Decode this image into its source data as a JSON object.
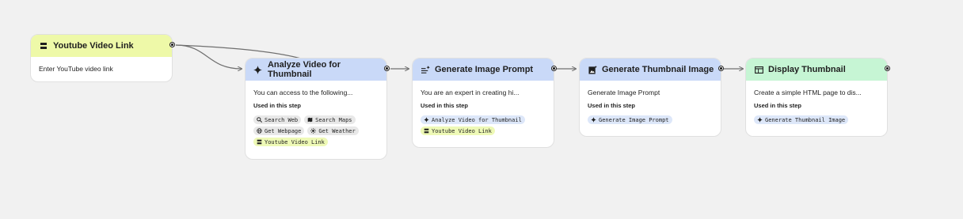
{
  "colors": {
    "canvas_bg": "#f1f1f1",
    "input_header": "#eef9a8",
    "generate_header": "#c9d9f8",
    "output_header": "#c6f5d4",
    "chip_link": "#eef9b6",
    "chip_ai": "#dde7f9",
    "chip_tool": "#e8e8e8"
  },
  "nodes": {
    "youtube": {
      "title": "Youtube Video Link",
      "icon": "input-icon",
      "description": "Enter YouTube video link"
    },
    "analyze": {
      "title": "Analyze Video for Thumbnail",
      "icon": "sparkle-icon",
      "description": "You can access to the following...",
      "used_label": "Used in this step",
      "chips": [
        {
          "label": "Search Web",
          "icon": "search-icon"
        },
        {
          "label": "Search Maps",
          "icon": "map-icon"
        },
        {
          "label": "Get Webpage",
          "icon": "globe-icon"
        },
        {
          "label": "Get Weather",
          "icon": "sun-icon"
        },
        {
          "label": "Youtube Video Link",
          "icon": "input-icon"
        }
      ]
    },
    "prompt": {
      "title": "Generate Image Prompt",
      "icon": "text-generate-icon",
      "description": "You are an expert in creating hi...",
      "used_label": "Used in this step",
      "chips": [
        {
          "label": "Analyze Video for Thumbnail",
          "icon": "sparkle-icon"
        },
        {
          "label": "Youtube Video Link",
          "icon": "input-icon"
        }
      ]
    },
    "image": {
      "title": "Generate Thumbnail Image",
      "icon": "image-generate-icon",
      "description": "Generate Image Prompt",
      "used_label": "Used in this step",
      "chips": [
        {
          "label": "Generate Image Prompt",
          "icon": "sparkle-icon"
        }
      ]
    },
    "display": {
      "title": "Display Thumbnail",
      "icon": "display-icon",
      "description": "Create a simple HTML page to dis...",
      "used_label": "Used in this step",
      "chips": [
        {
          "label": "Generate Thumbnail Image",
          "icon": "sparkle-icon"
        }
      ]
    }
  }
}
